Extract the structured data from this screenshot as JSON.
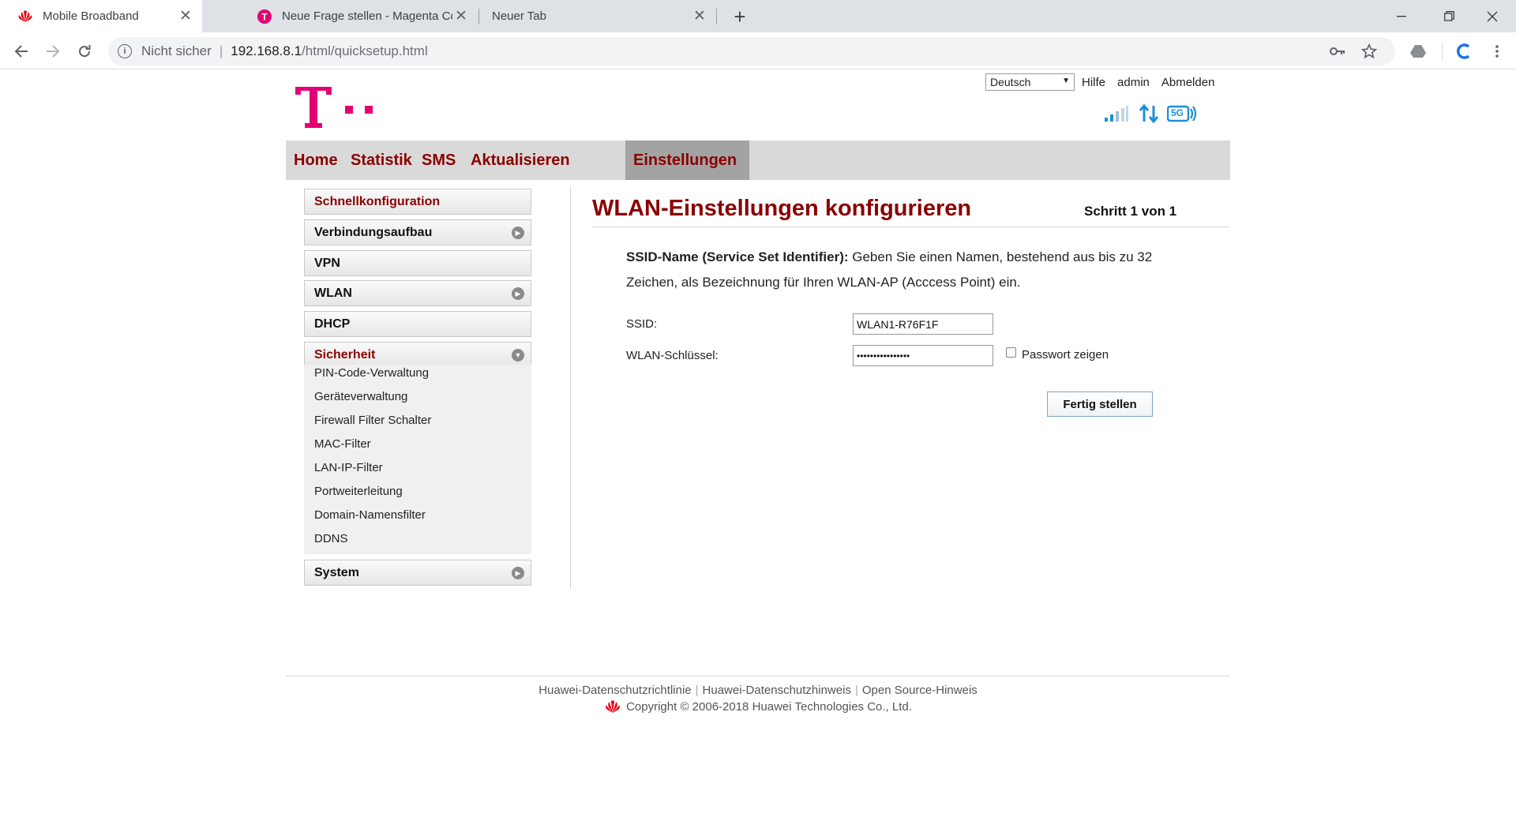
{
  "browser": {
    "tabs": [
      {
        "title": "Mobile Broadband",
        "active": true
      },
      {
        "title": "Neue Frage stellen - Magenta Co",
        "active": false
      },
      {
        "title": "Neuer Tab",
        "active": false
      }
    ],
    "address": {
      "security_text": "Nicht sicher",
      "separator": "|",
      "host": "192.168.8.1",
      "path": "/html/quicksetup.html"
    }
  },
  "header": {
    "language": "Deutsch",
    "links": {
      "help": "Hilfe",
      "user": "admin",
      "logout": "Abmelden"
    },
    "status": {
      "network_badge": "5G"
    }
  },
  "nav": {
    "items": [
      {
        "label": "Home"
      },
      {
        "label": "Statistik"
      },
      {
        "label": "SMS"
      },
      {
        "label": "Aktualisieren"
      },
      {
        "label": "Einstellungen",
        "active": true
      }
    ]
  },
  "sidebar": {
    "items": [
      {
        "label": "Schnellkonfiguration",
        "active": true
      },
      {
        "label": "Verbindungsaufbau"
      },
      {
        "label": "VPN"
      },
      {
        "label": "WLAN"
      },
      {
        "label": "DHCP"
      },
      {
        "label": "Sicherheit",
        "expanded": true
      },
      {
        "label": "System"
      }
    ],
    "security_submenu": [
      "PIN-Code-Verwaltung",
      "Geräteverwaltung",
      "Firewall Filter Schalter",
      "MAC-Filter",
      "LAN-IP-Filter",
      "Portweiterleitung",
      "Domain-Namensfilter",
      "DDNS"
    ]
  },
  "main": {
    "title": "WLAN-Einstellungen konfigurieren",
    "step": "Schritt 1 von 1",
    "description_label": "SSID-Name (Service Set Identifier):",
    "description_text": " Geben Sie einen Namen, bestehend aus bis zu 32 Zeichen, als Bezeichnung für Ihren WLAN-AP (Acccess Point) ein.",
    "ssid_label": "SSID:",
    "ssid_value": "WLAN1-R76F1F",
    "key_label": "WLAN-Schlüssel:",
    "key_value": "••••••••••••••••",
    "show_password_label": "Passwort zeigen",
    "finish_button": "Fertig stellen"
  },
  "footer": {
    "links": [
      "Huawei-Datenschutzrichtlinie",
      "Huawei-Datenschutzhinweis",
      "Open Source-Hinweis"
    ],
    "separator": "|",
    "copyright": "Copyright © 2006-2018 Huawei Technologies Co., Ltd."
  },
  "colors": {
    "brand_magenta": "#e20074",
    "menu_red": "#8b0000",
    "huawei_red": "#e60012",
    "status_blue": "#1e8fd6"
  }
}
